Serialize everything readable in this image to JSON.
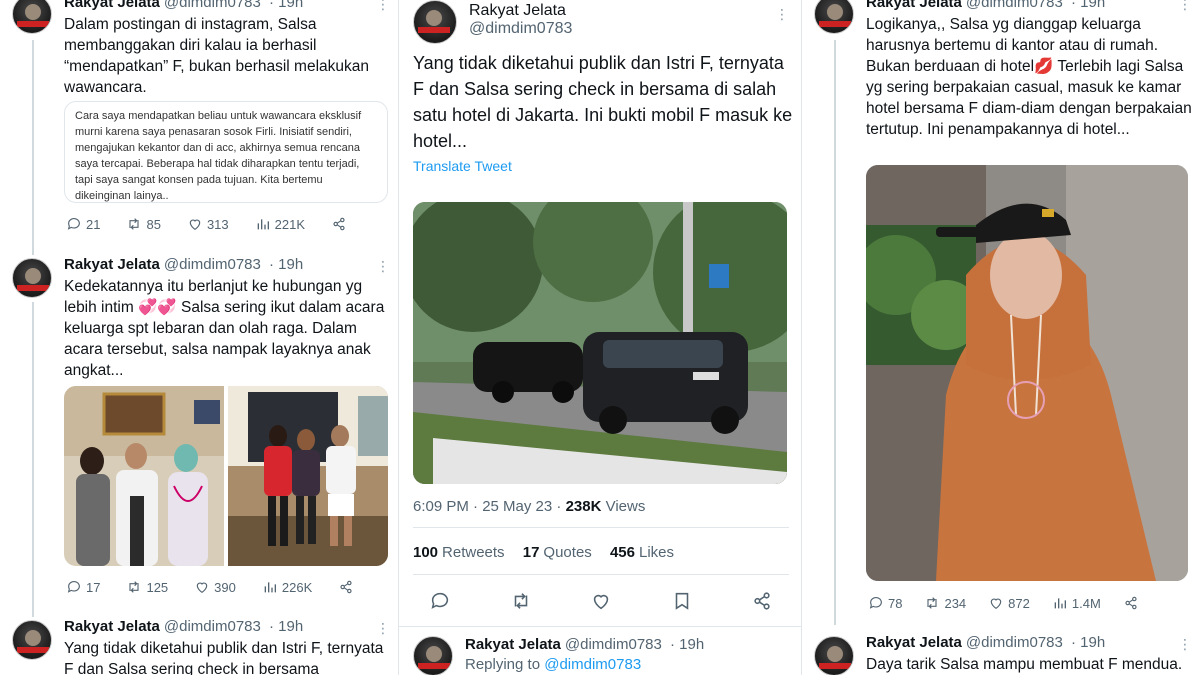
{
  "left": {
    "t1": {
      "name": "Rakyat Jelata",
      "handle": "@dimdim0783",
      "time": "· 19h",
      "text": "Dalam postingan di instagram, Salsa membanggakan diri kalau ia berhasil “mendapatkan” F, bukan berhasil melakukan wawancara.",
      "quote": "Cara saya mendapatkan beliau untuk wawancara eksklusif murni karena saya penasaran sosok Firli. Inisiatif sendiri, mengajukan kekantor dan di acc, akhirnya semua rencana saya tercapai. Beberapa hal tidak diharapkan tentu terjadi, tapi saya sangat konsen pada tujuan. Kita bertemu dikeinginan lainya..",
      "replies": "21",
      "retweets": "85",
      "likes": "313",
      "views": "221K"
    },
    "t2": {
      "name": "Rakyat Jelata",
      "handle": "@dimdim0783",
      "time": "· 19h",
      "text_a": "Kedekatannya itu berlanjut ke hubungan yg lebih intim ",
      "emoji": "💞💞",
      "text_b": " Salsa sering ikut dalam acara keluarga spt lebaran dan olah raga. Dalam acara tersebut, salsa nampak layaknya anak angkat...",
      "replies": "17",
      "retweets": "125",
      "likes": "390",
      "views": "226K"
    },
    "t3": {
      "name": "Rakyat Jelata",
      "handle": "@dimdim0783",
      "time": "· 19h",
      "text": "Yang tidak diketahui publik dan Istri F, ternyata F dan Salsa sering check in bersama"
    }
  },
  "mid": {
    "name": "Rakyat Jelata",
    "handle": "@dimdim0783",
    "text": "Yang tidak diketahui publik dan Istri F, ternyata F dan Salsa sering check in bersama di salah satu hotel di Jakarta. Ini bukti mobil F masuk ke hotel...",
    "translate": "Translate Tweet",
    "time": "6:09 PM · 25 May 23 · ",
    "views_count": "238K",
    "views_label": "Views",
    "retweets_count": "100",
    "retweets_label": "Retweets",
    "quotes_count": "17",
    "quotes_label": "Quotes",
    "likes_count": "456",
    "likes_label": "Likes",
    "reply": {
      "name": "Rakyat Jelata",
      "handle": "@dimdim0783",
      "time": "· 19h",
      "replying_label": "Replying to ",
      "replying_handle": "@dimdim0783"
    }
  },
  "right": {
    "t1": {
      "name": "Rakyat Jelata",
      "handle": "@dimdim0783",
      "time": "· 19h",
      "text_a": "Logikanya,, Salsa yg dianggap  keluarga harusnya bertemu di kantor atau di rumah. Bukan berduaan di hotel",
      "emoji": "💋",
      "text_b": " Terlebih lagi Salsa yg sering berpakaian casual, masuk ke kamar hotel bersama F diam-diam dengan berpakaian tertutup. Ini penampakannya di hotel...",
      "replies": "78",
      "retweets": "234",
      "likes": "872",
      "views": "1.4M"
    },
    "t2": {
      "name": "Rakyat Jelata",
      "handle": "@dimdim0783",
      "time": "· 19h",
      "text": "Daya tarik Salsa mampu membuat F mendua."
    }
  },
  "colors": {
    "accent": "#1d9bf0",
    "text": "#0f1419",
    "muted": "#536471"
  }
}
